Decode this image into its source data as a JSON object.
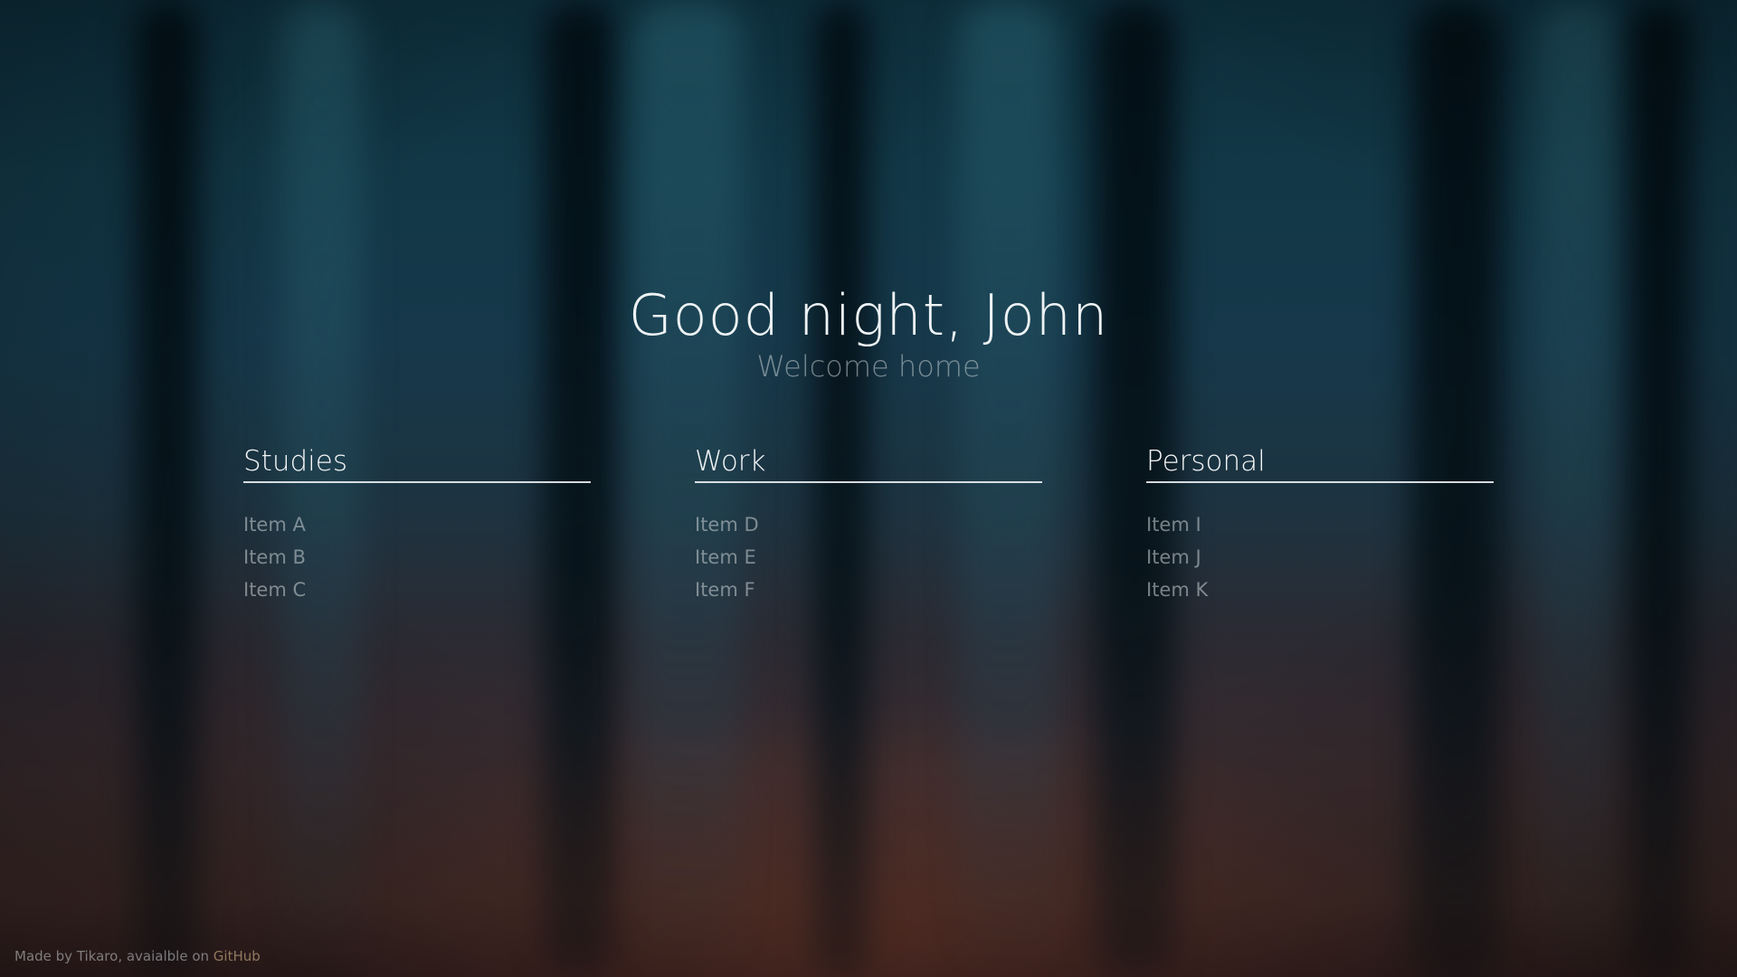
{
  "greeting": "Good night, John",
  "subtitle": "Welcome home",
  "columns": [
    {
      "title": "Studies",
      "items": [
        "Item A",
        "Item B",
        "Item C"
      ]
    },
    {
      "title": "Work",
      "items": [
        "Item D",
        "Item E",
        "Item F"
      ]
    },
    {
      "title": "Personal",
      "items": [
        "Item I",
        "Item J",
        "Item K"
      ]
    }
  ],
  "footer": {
    "text": "Made by Tikaro, avaialble on ",
    "link_label": "GitHub"
  },
  "colors": {
    "background_top": "#0d2d3a",
    "background_bottom": "#3e2a27",
    "heading": "#eef3f5",
    "link": "#c8aa82"
  }
}
